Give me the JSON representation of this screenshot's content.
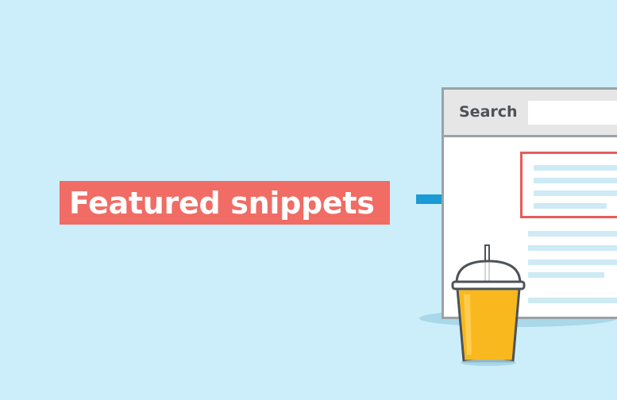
{
  "label": {
    "text": "Featured snippets"
  },
  "browser": {
    "search_label": "Search",
    "search_value": ""
  },
  "icons": {
    "arrow": "arrow-right-icon",
    "cup": "drink-cup-icon"
  },
  "colors": {
    "background": "#cbeefa",
    "label_background": "#f06c64",
    "label_text": "#ffffff",
    "arrow": "#1b9ad6",
    "snippet_border": "#e85b57",
    "placeholder_lines": "#cdeaf5",
    "browser_header": "#e6e6e6",
    "browser_border": "#9aa2a6",
    "drink": "#f9b81d"
  }
}
